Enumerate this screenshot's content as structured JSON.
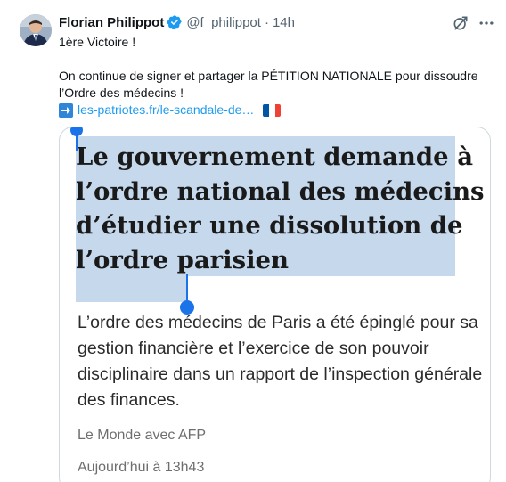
{
  "tweet": {
    "author_name": "Florian Philippot",
    "handle": "@f_philippot",
    "separator": "·",
    "time": "14h",
    "line1": "1ère Victoire !",
    "line2": "On continue de signer et partager la PÉTITION NATIONALE pour dissoudre l’Ordre des médecins !",
    "link_text": "les-patriotes.fr/le-scandale-de…"
  },
  "card": {
    "headline": "Le gouvernement demande à l’ordre national des médecins d’étudier une dissolution de l’ordre parisien",
    "summary": "L’ordre des médecins de Paris a été épinglé pour sa gestion financière et l’exercice de son pouvoir disciplinaire dans un rapport de l’inspection générale des finances.",
    "source": "Le Monde avec AFP",
    "date": "Aujourd’hui à 13h43"
  },
  "icons": {
    "verified": "verified-badge-icon",
    "grok": "grok-icon",
    "more": "more-options-icon",
    "arrow": "right-arrow-emoji",
    "flag": "france-flag-emoji"
  },
  "colors": {
    "link": "#1d9bf0",
    "selection": "#c5d8ec",
    "selection_handle": "#1a73e8",
    "verified": "#1d9bf0"
  }
}
